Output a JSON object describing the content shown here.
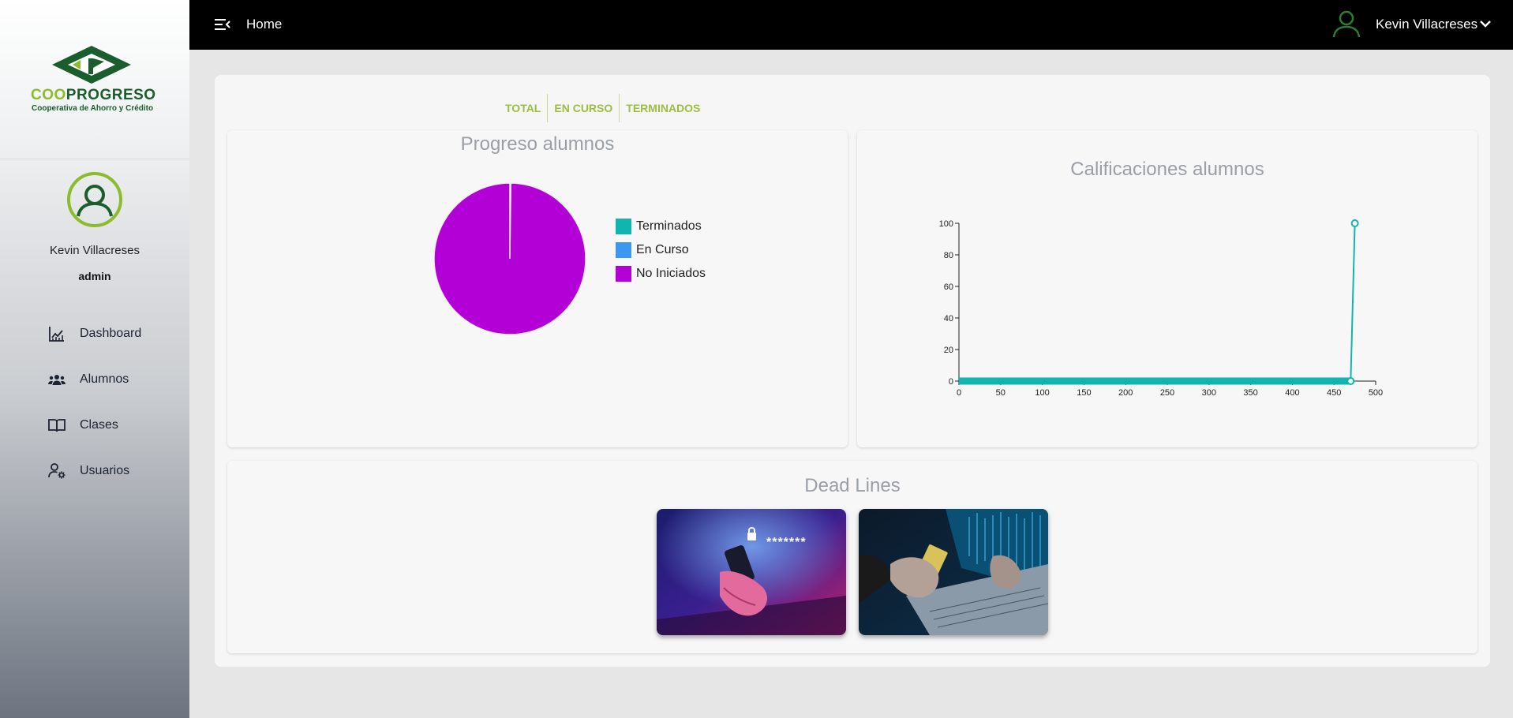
{
  "sidebar": {
    "logo": {
      "brand_part1": "COO",
      "brand_part2": "PROGRESO",
      "subtitle": "Cooperativa de Ahorro y Crédito"
    },
    "user": {
      "name": "Kevin Villacreses",
      "role": "admin"
    },
    "items": [
      {
        "label": "Dashboard",
        "icon": "chart-line-icon"
      },
      {
        "label": "Alumnos",
        "icon": "users-icon"
      },
      {
        "label": "Clases",
        "icon": "book-icon"
      },
      {
        "label": "Usuarios",
        "icon": "user-gear-icon"
      }
    ]
  },
  "topbar": {
    "home_label": "Home",
    "user_name": "Kevin Villacreses"
  },
  "tabs": [
    "TOTAL",
    "EN CURSO",
    "TERMINADOS"
  ],
  "progress_panel": {
    "title": "Progreso alumnos",
    "legend": [
      {
        "label": "Terminados",
        "color": "#0fb5ae"
      },
      {
        "label": "En Curso",
        "color": "#3b97f0"
      },
      {
        "label": "No Iniciados",
        "color": "#b300d6"
      }
    ]
  },
  "grades_panel": {
    "title": "Calificaciones alumnos"
  },
  "deadlines_panel": {
    "title": "Dead Lines",
    "card1_overlay_text": "*******"
  },
  "colors": {
    "accent": "#9bc03e",
    "brand_dark": "#1b5e2d",
    "line": "#0fb5ae"
  },
  "chart_data": [
    {
      "type": "pie",
      "title": "Progreso alumnos",
      "categories": [
        "Terminados",
        "En Curso",
        "No Iniciados"
      ],
      "values": [
        1,
        0,
        470
      ],
      "legend": "right"
    },
    {
      "type": "line",
      "title": "Calificaciones alumnos",
      "x": [
        0,
        470,
        475
      ],
      "series": [
        {
          "values": [
            0,
            0,
            100
          ]
        }
      ],
      "xlim": [
        0,
        500
      ],
      "ylim": [
        0,
        100
      ],
      "xticks": [
        0,
        50,
        100,
        150,
        200,
        250,
        300,
        350,
        400,
        450,
        500
      ],
      "yticks": [
        0,
        20,
        40,
        60,
        80,
        100
      ],
      "grid": false
    }
  ]
}
